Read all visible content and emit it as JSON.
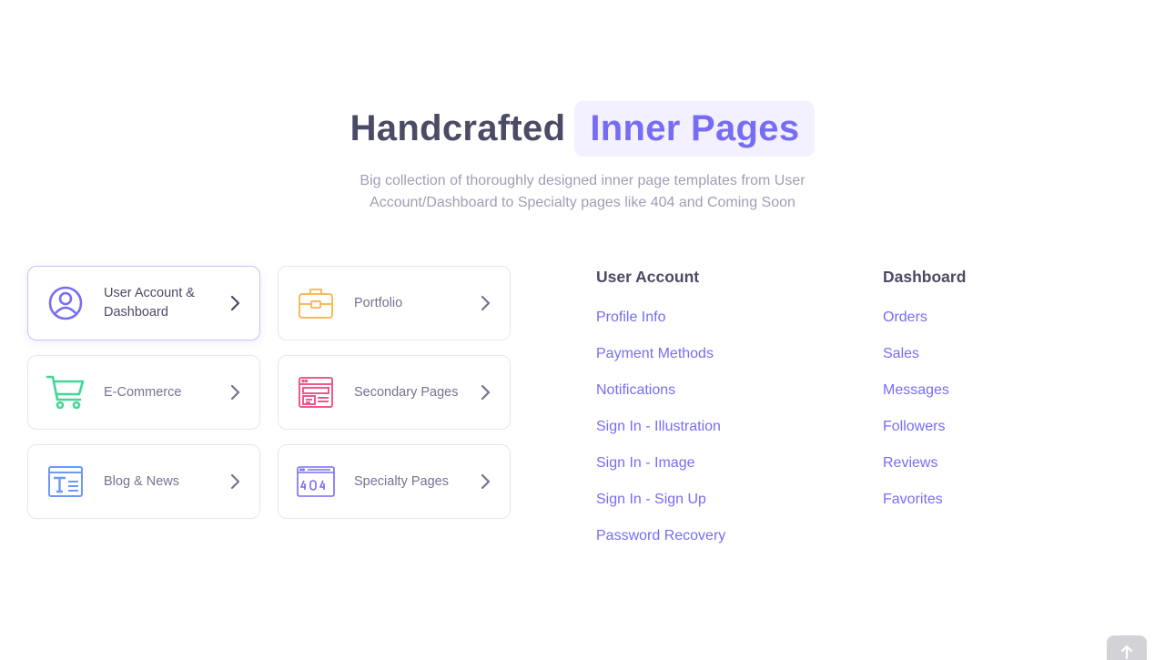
{
  "hero": {
    "title_main": "Handcrafted",
    "title_highlight": "Inner Pages",
    "subtitle": "Big collection of thoroughly designed inner page templates from User Account/Dashboard to Specialty pages like 404 and Coming Soon"
  },
  "cards": [
    {
      "label": "User Account & Dashboard",
      "icon": "user-circle-icon",
      "color": "#766df4"
    },
    {
      "label": "Portfolio",
      "icon": "briefcase-icon",
      "color": "#fbb960"
    },
    {
      "label": "E-Commerce",
      "icon": "cart-icon",
      "color": "#42d697"
    },
    {
      "label": "Secondary Pages",
      "icon": "browser-layout-icon",
      "color": "#f0588e"
    },
    {
      "label": "Blog & News",
      "icon": "text-document-icon",
      "color": "#6a9bf4"
    },
    {
      "label": "Specialty Pages",
      "icon": "error-404-icon",
      "color": "#766df4"
    }
  ],
  "user_account": {
    "heading": "User Account",
    "links": [
      "Profile Info",
      "Payment Methods",
      "Notifications",
      "Sign In - Illustration",
      "Sign In - Image",
      "Sign In - Sign Up",
      "Password Recovery"
    ]
  },
  "dashboard": {
    "heading": "Dashboard",
    "links": [
      "Orders",
      "Sales",
      "Messages",
      "Followers",
      "Reviews",
      "Favorites"
    ]
  },
  "icons": {
    "chevron": "chevron-right-icon",
    "back_to_top": "arrow-up-icon"
  },
  "colors": {
    "accent": "#766df4",
    "heading": "#4a4b65",
    "muted": "#9e9fb4"
  }
}
